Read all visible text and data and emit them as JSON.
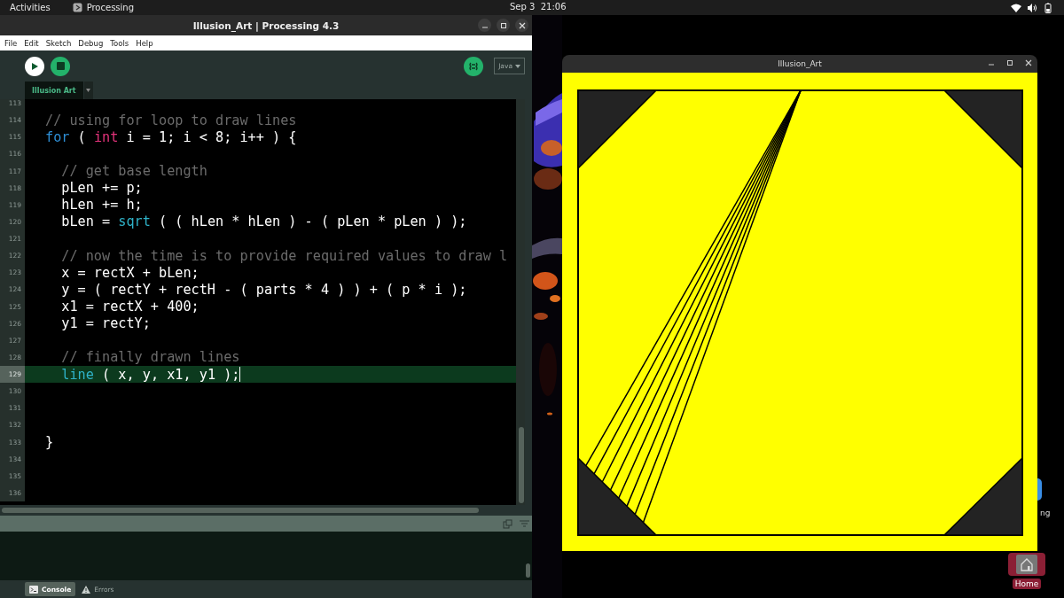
{
  "top_bar": {
    "activities": "Activities",
    "app": "Processing",
    "clock": "Sep 3  21:06"
  },
  "ide": {
    "title": "Illusion_Art | Processing 4.3",
    "menu": [
      "File",
      "Edit",
      "Sketch",
      "Debug",
      "Tools",
      "Help"
    ],
    "mode": "Java",
    "tabs": [
      {
        "label": "Illusion Art",
        "selected": true
      }
    ],
    "lines": [
      {
        "number": "113",
        "highlighted": false
      },
      {
        "number": "114",
        "highlighted": false,
        "tokens": [
          {
            "text": "// using for loop to draw lines",
            "kind": "comment"
          }
        ]
      },
      {
        "number": "115",
        "highlighted": false,
        "tokens": [
          {
            "text": "for",
            "kind": "keyword"
          },
          {
            "text": " ( ",
            "kind": "plain"
          },
          {
            "text": "int",
            "kind": "type"
          },
          {
            "text": " i = 1; i < 8; i++ ) {",
            "kind": "plain"
          }
        ]
      },
      {
        "number": "116",
        "highlighted": false
      },
      {
        "number": "117",
        "highlighted": false,
        "tokens": [
          {
            "text": "  // get base length",
            "kind": "comment"
          }
        ]
      },
      {
        "number": "118",
        "highlighted": false,
        "tokens": [
          {
            "text": "  pLen += p;",
            "kind": "plain"
          }
        ]
      },
      {
        "number": "119",
        "highlighted": false,
        "tokens": [
          {
            "text": "  hLen += h;",
            "kind": "plain"
          }
        ]
      },
      {
        "number": "120",
        "highlighted": false,
        "tokens": [
          {
            "text": "  bLen = ",
            "kind": "plain"
          },
          {
            "text": "sqrt",
            "kind": "function"
          },
          {
            "text": " ( ( hLen * hLen ) - ( pLen * pLen ) );",
            "kind": "plain"
          }
        ]
      },
      {
        "number": "121",
        "highlighted": false
      },
      {
        "number": "122",
        "highlighted": false,
        "tokens": [
          {
            "text": "  // now the time is to provide required values to draw l",
            "kind": "comment"
          }
        ]
      },
      {
        "number": "123",
        "highlighted": false,
        "tokens": [
          {
            "text": "  x = rectX + bLen;",
            "kind": "plain"
          }
        ]
      },
      {
        "number": "124",
        "highlighted": false,
        "tokens": [
          {
            "text": "  y = ( rectY + rectH - ( parts * 4 ) ) + ( p * i );",
            "kind": "plain"
          }
        ]
      },
      {
        "number": "125",
        "highlighted": false,
        "tokens": [
          {
            "text": "  x1 = rectX + 400;",
            "kind": "plain"
          }
        ]
      },
      {
        "number": "126",
        "highlighted": false,
        "tokens": [
          {
            "text": "  y1 = rectY;",
            "kind": "plain"
          }
        ]
      },
      {
        "number": "127",
        "highlighted": false
      },
      {
        "number": "128",
        "highlighted": false,
        "tokens": [
          {
            "text": "  // finally drawn lines",
            "kind": "comment"
          }
        ]
      },
      {
        "number": "129",
        "highlighted": true,
        "tokens": [
          {
            "text": "  line",
            "kind": "function"
          },
          {
            "text": " ( x, y, x1, y1 );",
            "kind": "plain"
          }
        ]
      },
      {
        "number": "130",
        "highlighted": false
      },
      {
        "number": "131",
        "highlighted": false
      },
      {
        "number": "132",
        "highlighted": false
      },
      {
        "number": "133",
        "highlighted": false,
        "tokens": [
          {
            "text": "}",
            "kind": "plain"
          }
        ]
      },
      {
        "number": "134",
        "highlighted": false
      },
      {
        "number": "135",
        "highlighted": false
      },
      {
        "number": "136",
        "highlighted": false
      }
    ],
    "console_tabs": [
      {
        "label": "Console",
        "selected": true
      },
      {
        "label": "Errors",
        "selected": false
      }
    ]
  },
  "sketch_window": {
    "title": "Illusion_Art"
  },
  "desktop_icons": [
    {
      "label": "ng",
      "selected": false
    },
    {
      "label": "Home",
      "selected": true
    }
  ]
}
